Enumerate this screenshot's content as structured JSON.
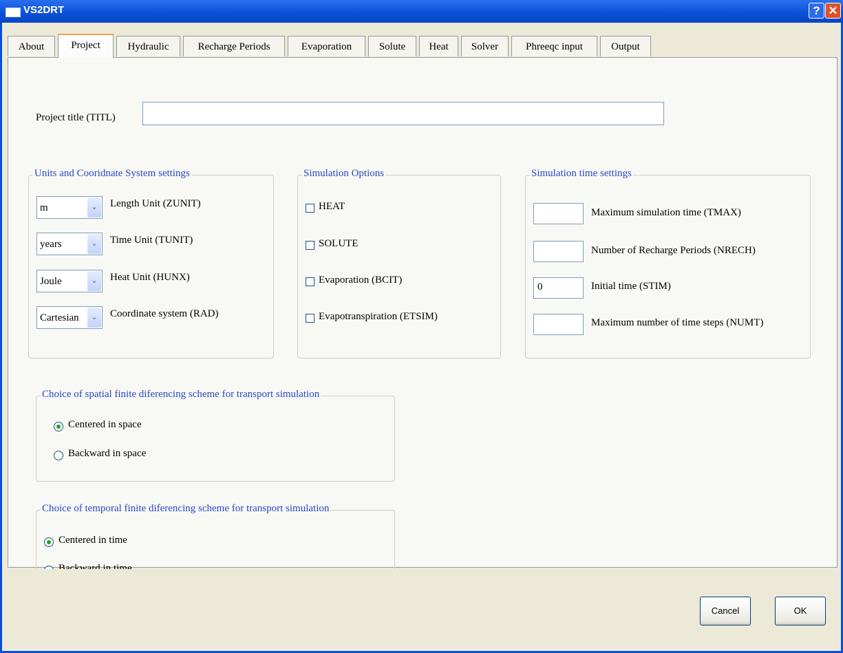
{
  "window": {
    "title": "VS2DRT",
    "help_glyph": "?",
    "close_glyph": "✕"
  },
  "tabs": [
    "About",
    "Project",
    "Hydraulic",
    "Recharge Periods",
    "Evaporation",
    "Solute",
    "Heat",
    "Solver",
    "Phreeqc input",
    "Output"
  ],
  "active_tab": "Project",
  "project": {
    "title_label": "Project title (TITL)",
    "title_value": ""
  },
  "units": {
    "title": "Units and Cooridnate System settings",
    "rows": [
      {
        "value": "m",
        "label": "Length Unit (ZUNIT)"
      },
      {
        "value": "years",
        "label": "Time Unit (TUNIT)"
      },
      {
        "value": "Joule",
        "label": "Heat Unit (HUNX)"
      },
      {
        "value": "Cartesian",
        "label": "Coordinate system (RAD)"
      }
    ],
    "arrow_glyph": "⌄"
  },
  "sim_options": {
    "title": "Simulation Options",
    "items": [
      {
        "label": "HEAT",
        "checked": false
      },
      {
        "label": "SOLUTE",
        "checked": false
      },
      {
        "label": "Evaporation (BCIT)",
        "checked": false
      },
      {
        "label": "Evapotranspiration (ETSIM)",
        "checked": false
      }
    ]
  },
  "time_settings": {
    "title": "Simulation time settings",
    "rows": [
      {
        "value": "",
        "label": "Maximum simulation time (TMAX)"
      },
      {
        "value": "",
        "label": "Number of Recharge Periods (NRECH)"
      },
      {
        "value": "0",
        "label": "Initial time (STIM)"
      },
      {
        "value": "",
        "label": "Maximum number of time steps (NUMT)"
      }
    ]
  },
  "spatial_scheme": {
    "title": "Choice of spatial finite diferencing scheme for transport simulation",
    "options": [
      {
        "label": "Centered in space",
        "selected": true
      },
      {
        "label": "Backward in space",
        "selected": false
      }
    ]
  },
  "temporal_scheme": {
    "title": "Choice of temporal finite diferencing scheme for transport simulation",
    "options": [
      {
        "label": "Centered in time",
        "selected": true
      },
      {
        "label": "Backward in time",
        "selected": false
      }
    ]
  },
  "buttons": {
    "cancel": "Cancel",
    "ok": "OK"
  },
  "colors": {
    "group_title": "#2a47c7",
    "title_bar": "#0a4fd6",
    "radio_dot": "#21a121",
    "active_tab_accent": "#f7a13c"
  }
}
